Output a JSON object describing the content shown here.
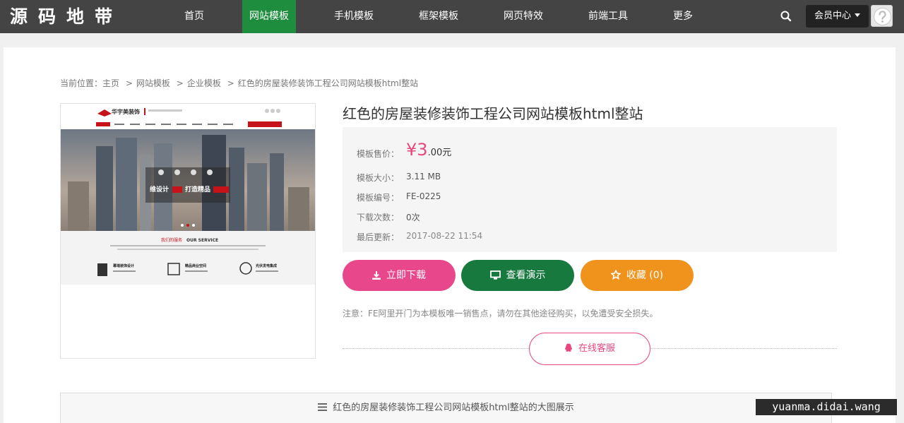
{
  "header": {
    "logo_text": "源码地带",
    "nav": [
      {
        "label": "首页",
        "active": false
      },
      {
        "label": "网站模板",
        "active": true
      },
      {
        "label": "手机模板",
        "active": false
      },
      {
        "label": "框架模板",
        "active": false
      },
      {
        "label": "网页特效",
        "active": false
      },
      {
        "label": "前端工具",
        "active": false
      },
      {
        "label": "更多",
        "active": false
      }
    ],
    "search_icon": "search-icon",
    "member_label": "会员中心",
    "avatar_icon": "user-avatar-icon"
  },
  "breadcrumb": {
    "prefix": "当前位置：",
    "items": [
      "主页",
      "网站模板",
      "企业模板",
      "红色的房屋装修装饰工程公司网站模板html整站"
    ],
    "separator": ">"
  },
  "preview": {
    "brand": "华宇美装饰",
    "slogan_a": "维设计",
    "slogan_b": "打造精品",
    "service_title_cn": "我们的服务",
    "service_title_en": "OUR SERVICE",
    "col1": "幕墙装饰设计",
    "col2": "精品商业空间",
    "col3": "光伏发电集成"
  },
  "product": {
    "title": "红色的房屋装修装饰工程公司网站模板html整站",
    "price_label": "模板售价：",
    "price_symbol": "¥",
    "price_int": "3",
    "price_rest": ".00元",
    "size_label": "模板大小：",
    "size_value": "3.11 MB",
    "code_label": "模板编号：",
    "code_value": "FE-0225",
    "downloads_label": "下载次数：",
    "downloads_value": "0次",
    "updated_label": "最后更新：",
    "updated_value": "2017-08-22 11:54"
  },
  "actions": {
    "download_label": "立即下载",
    "demo_label": "查看演示",
    "favorite_label": "收藏 (0)",
    "service_label": "在线客服"
  },
  "notice": "注意：FE阿里开门为本模板唯一销售点，请勿在其他途径购买，以免遭受安全损失。",
  "big_image_bar": "红色的房屋装修装饰工程公司网站模板html整站的大图展示",
  "watermark": "yuanma.didai.wang",
  "colors": {
    "nav_bg": "#444444",
    "nav_active": "#1e8e3e",
    "pink": "#e9478c",
    "green": "#17793e",
    "orange": "#f0931d"
  }
}
